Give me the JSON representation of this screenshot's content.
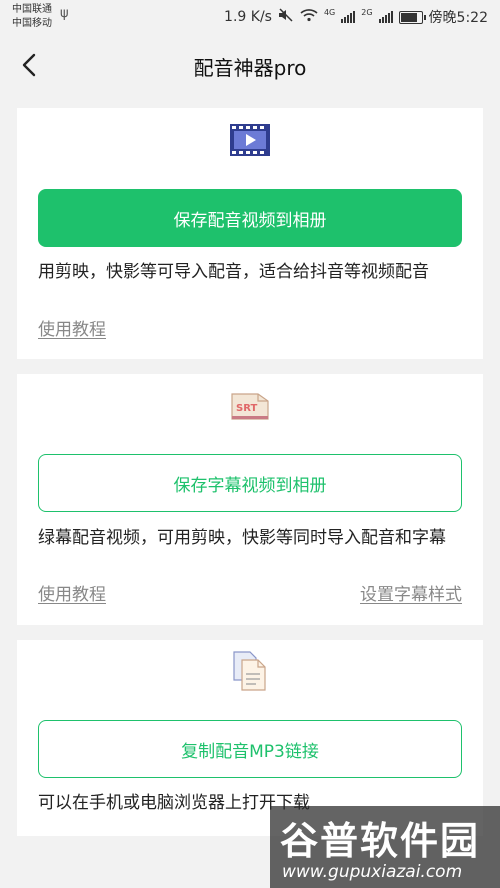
{
  "status_bar": {
    "carrier_1": "中国联通",
    "carrier_2": "中国移动",
    "speed": "1.9 K/s",
    "network_1": "4G",
    "network_2": "2G",
    "time": "傍晚5:22",
    "battery_level": 0.9
  },
  "header": {
    "title": "配音神器pro"
  },
  "cards": [
    {
      "icon": "video-film-icon",
      "button_label": "保存配音视频到相册",
      "description": "用剪映，快影等可导入配音，适合给抖音等视频配音",
      "tutorial_link": "使用教程"
    },
    {
      "icon": "srt-subtitle-icon",
      "icon_text": "SRT",
      "button_label": "保存字幕视频到相册",
      "description": "绿幕配音视频，可用剪映，快影等同时导入配音和字幕",
      "tutorial_link": "使用教程",
      "settings_link": "设置字幕样式"
    },
    {
      "icon": "copy-document-icon",
      "button_label": "复制配音MP3链接",
      "description": "可以在手机或电脑浏览器上打开下载"
    }
  ],
  "watermark": {
    "title": "谷普软件园",
    "url": "www.gupuxiazai.com"
  },
  "colors": {
    "accent": "#1ec16c",
    "background": "#f2f2f2",
    "link": "#888888",
    "icon_blue": "#2f3d8f"
  }
}
